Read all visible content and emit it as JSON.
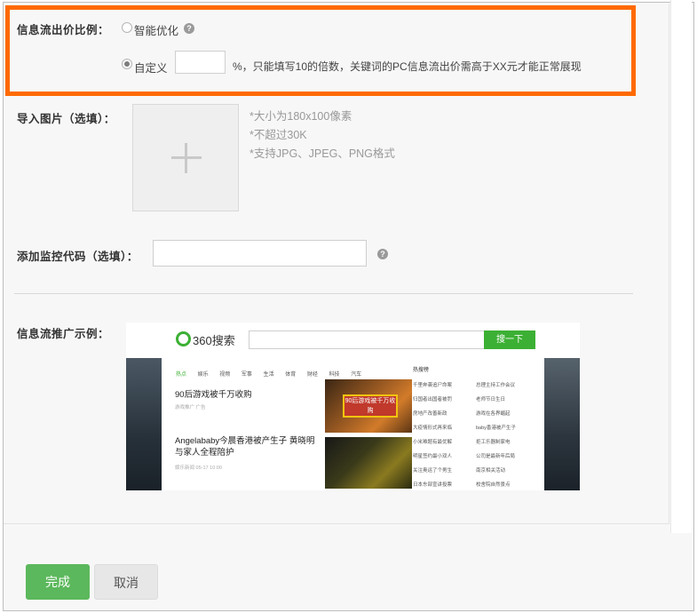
{
  "bid_ratio": {
    "label": "信息流出价比例：",
    "option_smart": "智能优化",
    "option_custom": "自定义",
    "custom_value": "",
    "percent_note": "%，只能填写10的倍数，关键词的PC信息流出价需高于XX元才能正常展现",
    "selected": "自定义"
  },
  "image_upload": {
    "label": "导入图片（选填）：",
    "hints": [
      "*大小为180x100像素",
      "*不超过30K",
      "*支持JPG、JPEG、PNG格式"
    ]
  },
  "monitor_code": {
    "label": "添加监控代码（选填）：",
    "value": ""
  },
  "example": {
    "label": "信息流推广示例：",
    "logo_text": "360搜索",
    "search_button": "搜一下",
    "nav_tabs": [
      "热点",
      "娱乐",
      "视频",
      "军事",
      "生活",
      "体育",
      "财经",
      "科技",
      "汽车"
    ],
    "headline1": "90后游戏被千万收购",
    "meta1": "游戏推广 广告",
    "headline2": "Angelababy今晨香港被产生子 黄晓明与家人全程陪护",
    "meta2": "娱乐新闻 05-17 10:00",
    "image1_badge": "90后游戏被千万收购",
    "hot_title": "热搜榜",
    "hot_left": [
      "千里奔袭追尸命案",
      "归国者出国者被罚",
      "房地产改善新政",
      "大疫情形式再来临",
      "小米难题有最优解",
      "明星签约最小双人",
      "关注奥运了个男生",
      "日本东部宣讲投票"
    ],
    "hot_right": [
      "总理主持工作会议",
      "老师节日生日",
      "游戏在各界崛起",
      "baby香港被产生子",
      "拒工乐器制家电",
      "公司是最新年后局",
      "南京相关活动",
      "校舍院自然景点"
    ]
  },
  "actions": {
    "done": "完成",
    "cancel": "取消"
  },
  "colors": {
    "highlight": "#ff6a00",
    "primary_button": "#5cb85c",
    "brand_green": "#3cb034"
  }
}
